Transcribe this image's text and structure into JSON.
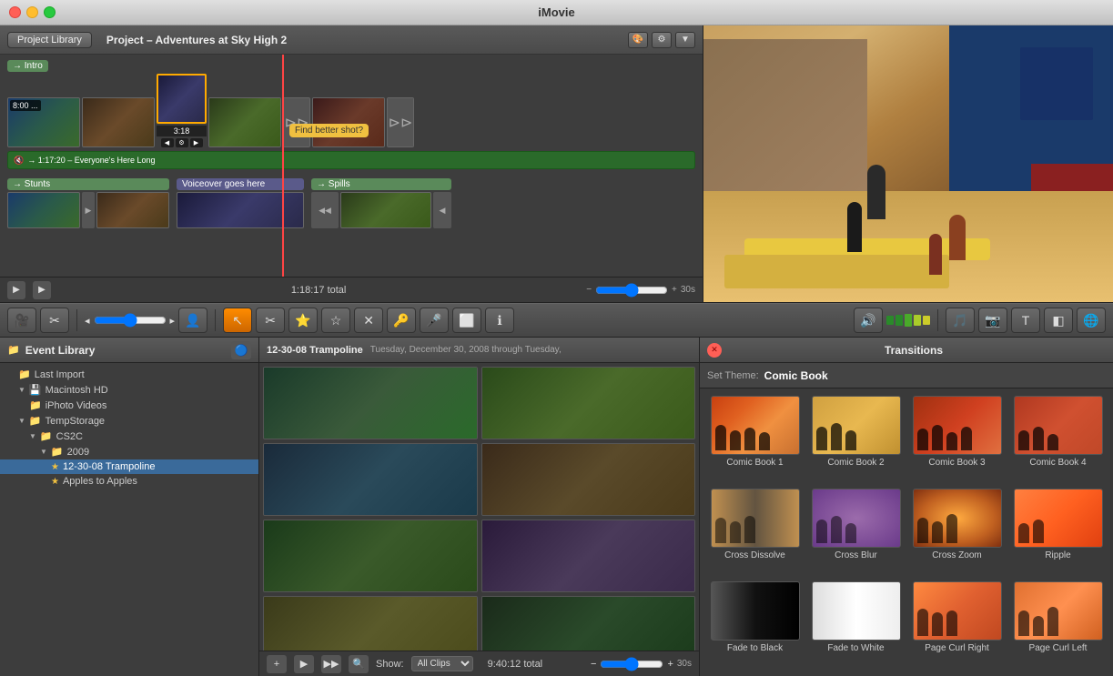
{
  "app": {
    "title": "iMovie"
  },
  "project": {
    "library_btn": "Project Library",
    "title": "Project – Adventures at Sky High 2",
    "intro_label": "→ Intro",
    "find_better_shot": "Find better shot?",
    "clip_duration": "3:18",
    "clip_time": "8:00 ...",
    "clip1_duration": "1:17:20",
    "audio_label": "→ 1:17:20 – Everyone's Here Long",
    "total_time": "1:18:17 total",
    "zoom_unit": "30s"
  },
  "tracks": {
    "stunts_label": "→ Stunts",
    "voiceover_label": "Voiceover goes here",
    "spills_label": "→ Spills"
  },
  "toolbar": {
    "icons": [
      "🎬",
      "✂️",
      "",
      "",
      "⭐",
      "☆",
      "✕",
      "🔑",
      "🎤",
      "⬜",
      "ℹ️"
    ]
  },
  "event_library": {
    "title": "Event Library",
    "items": [
      {
        "label": "Last Import",
        "indent": 1,
        "type": "folder"
      },
      {
        "label": "Macintosh HD",
        "indent": 1,
        "type": "hdd",
        "expanded": true
      },
      {
        "label": "iPhoto Videos",
        "indent": 2,
        "type": "folder"
      },
      {
        "label": "TempStorage",
        "indent": 1,
        "type": "folder",
        "expanded": true
      },
      {
        "label": "CS2C",
        "indent": 2,
        "type": "folder",
        "expanded": true
      },
      {
        "label": "2009",
        "indent": 3,
        "type": "folder",
        "expanded": true
      },
      {
        "label": "12-30-08 Trampoline",
        "indent": 4,
        "type": "star",
        "selected": true
      },
      {
        "label": "Apples to Apples",
        "indent": 4,
        "type": "star"
      }
    ]
  },
  "event_clips": {
    "name": "12-30-08 Trampoline",
    "date": "Tuesday, December 30, 2008 through Tuesday,",
    "total": "9:40:12 total",
    "show_label": "Show:",
    "show_value": "All Clips",
    "zoom_unit": "30s"
  },
  "transitions": {
    "title": "Transitions",
    "set_theme_label": "Set Theme:",
    "theme_name": "Comic Book",
    "items": [
      {
        "label": "Comic Book 1",
        "style": "t-comic1"
      },
      {
        "label": "Comic Book 2",
        "style": "t-comic2"
      },
      {
        "label": "Comic Book 3",
        "style": "t-comic3"
      },
      {
        "label": "Comic Book 4",
        "style": "t-comic4"
      },
      {
        "label": "Cross Dissolve",
        "style": "t-cross-dissolve"
      },
      {
        "label": "Cross Blur",
        "style": "t-cross-blur"
      },
      {
        "label": "Cross Zoom",
        "style": "t-cross-zoom"
      },
      {
        "label": "Ripple",
        "style": "t-ripple"
      },
      {
        "label": "Fade to Black",
        "style": "t-fade-black"
      },
      {
        "label": "Fade to White",
        "style": "t-fade-white"
      },
      {
        "label": "Page Curl Right",
        "style": "t-page-curl-r"
      },
      {
        "label": "Page Curl Left",
        "style": "t-page-curl-l"
      }
    ]
  }
}
